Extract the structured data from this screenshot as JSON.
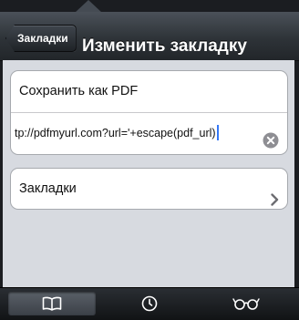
{
  "navbar": {
    "back_label": "Закладки",
    "title": "Изменить закладку"
  },
  "form": {
    "title_value": "Сохранить как PDF",
    "url_value": "tp://pdfmyurl.com?url='+escape(pdf_url)"
  },
  "folder_row": {
    "label": "Закладки"
  },
  "tabbar": {
    "tabs": [
      {
        "icon": "book-icon",
        "selected": true
      },
      {
        "icon": "clock-icon",
        "selected": false
      },
      {
        "icon": "glasses-icon",
        "selected": false
      }
    ]
  },
  "colors": {
    "accent_caret": "#3478f6",
    "content_bg": "#d7dae0",
    "navbar_top": "#4b5159"
  }
}
